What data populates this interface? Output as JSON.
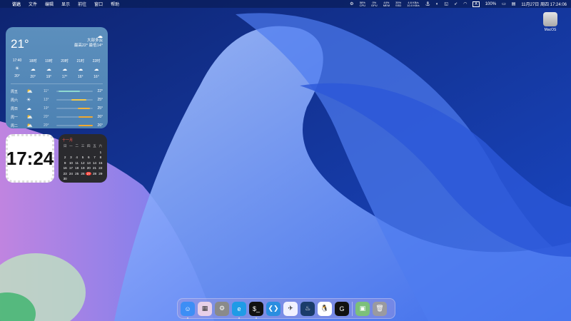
{
  "menubar": {
    "items": [
      "访达",
      "文件",
      "编辑",
      "显示",
      "前往",
      "窗口",
      "帮助"
    ],
    "stats": [
      {
        "v": "58%",
        "l": "CPU"
      },
      {
        "v": "0%",
        "l": "GPU"
      },
      {
        "v": "44%",
        "l": "MEM"
      },
      {
        "v": "35%",
        "l": "SSD"
      },
      {
        "v": "4.6 KB/s",
        "l": "10.0 KB/s"
      }
    ],
    "battery": "100%",
    "datetime": "11月27日 周四 17:24:06"
  },
  "weather": {
    "temp": "21°",
    "condition": "大部多云",
    "hilo": "最高22° 最低14°",
    "hours": [
      {
        "t": "17:40",
        "icon": "☀",
        "v": "20°"
      },
      {
        "t": "18时",
        "icon": "☁",
        "v": "20°"
      },
      {
        "t": "19时",
        "icon": "☁",
        "v": "19°"
      },
      {
        "t": "20时",
        "icon": "☁",
        "v": "17°"
      },
      {
        "t": "21时",
        "icon": "☁",
        "v": "16°"
      },
      {
        "t": "22时",
        "icon": "☁",
        "v": "16°"
      }
    ],
    "days": [
      {
        "d": "周五",
        "icon": "⛅",
        "lo": "11°",
        "hi": "22°",
        "range": [
          0.05,
          0.65
        ],
        "color": "#8fd9d0"
      },
      {
        "d": "周六",
        "icon": "☀",
        "lo": "13°",
        "hi": "25°",
        "range": [
          0.4,
          0.82
        ],
        "color": "#f2c94c"
      },
      {
        "d": "周日",
        "icon": "☁",
        "lo": "19°",
        "hi": "25°",
        "range": [
          0.58,
          0.92
        ],
        "color": "#f2b33d"
      },
      {
        "d": "周一",
        "icon": "⛅",
        "lo": "20°",
        "hi": "26°",
        "range": [
          0.6,
          1.0
        ],
        "color": "#f0a830"
      },
      {
        "d": "周二",
        "icon": "⛅",
        "lo": "20°",
        "hi": "26°",
        "range": [
          0.6,
          1.0
        ],
        "color": "#f0a830"
      }
    ]
  },
  "clock": "17:24",
  "calendar": {
    "month": "十一月",
    "weekdays": [
      "日",
      "一",
      "二",
      "三",
      "四",
      "五",
      "六"
    ],
    "lead_blanks": 6,
    "days": 30,
    "today": 27
  },
  "desktop": {
    "icon_label": "MacOS"
  },
  "dock": [
    {
      "name": "finder",
      "glyph": "☺",
      "bg": "#3d8ef5",
      "run": true
    },
    {
      "name": "launchpad",
      "glyph": "▦",
      "bg": "#e8d0e8",
      "run": false
    },
    {
      "name": "system-settings",
      "glyph": "⚙",
      "bg": "#8a8a8a",
      "run": false
    },
    {
      "name": "edge",
      "glyph": "e",
      "bg": "#1f9be6",
      "run": true
    },
    {
      "name": "terminal",
      "glyph": "$_",
      "bg": "#111",
      "run": true
    },
    {
      "name": "vscode",
      "glyph": "❮❯",
      "bg": "#2a8ee0",
      "run": false
    },
    {
      "name": "feishu",
      "glyph": "✈",
      "bg": "#f0f0ff",
      "run": false
    },
    {
      "name": "steam",
      "glyph": "♨",
      "bg": "#1b3c6b",
      "run": false
    },
    {
      "name": "qq",
      "glyph": "🐧",
      "bg": "#fff",
      "run": false
    },
    {
      "name": "logitech",
      "glyph": "G",
      "bg": "#111",
      "run": false
    }
  ],
  "dock_right": [
    {
      "name": "preview",
      "glyph": "▣",
      "bg": "#7cc07a"
    },
    {
      "name": "trash",
      "glyph": "🗑",
      "bg": "#9a9aa0"
    }
  ]
}
